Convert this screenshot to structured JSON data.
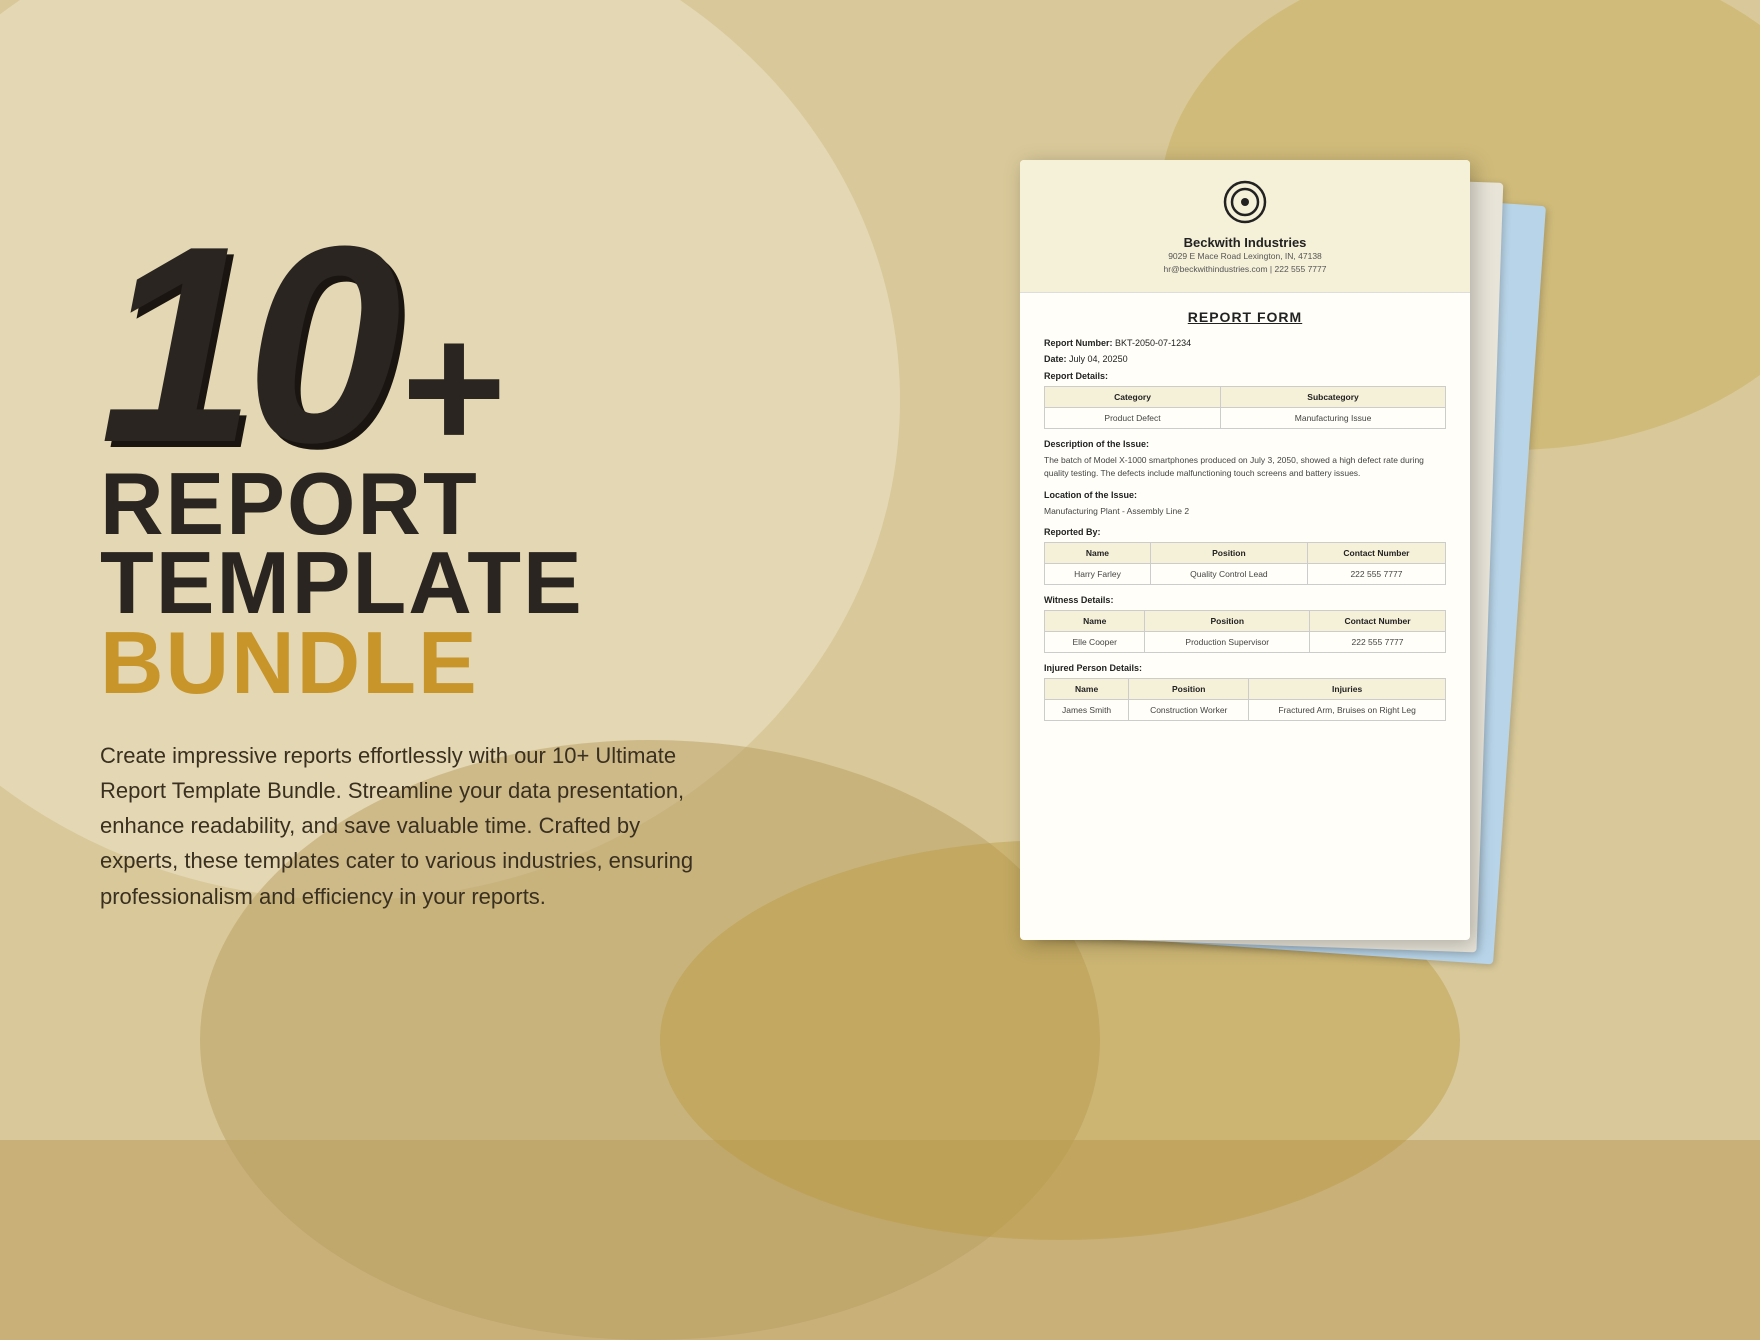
{
  "background": {
    "colors": {
      "main": "#d9c99a",
      "light_curve": "#e8ddbf",
      "dark_curve": "#b89d5e",
      "gold_curve": "#c4a84a"
    }
  },
  "left": {
    "big_number": "10",
    "plus_sign": "+",
    "line1": "REPORT",
    "line2": "TEMPLATE",
    "line3": "BUNDLE",
    "description": "Create impressive reports effortlessly with our 10+ Ultimate Report Template Bundle. Streamline your data presentation, enhance readability, and save valuable time. Crafted by experts, these templates cater to various industries, ensuring professionalism and efficiency in your reports."
  },
  "document": {
    "company": {
      "name": "Beckwith Industries",
      "address": "9029 E Mace Road Lexington, IN, 47138",
      "contact": "hr@beckwithindustries.com | 222 555 7777"
    },
    "title": "REPORT FORM",
    "report_number_label": "Report Number:",
    "report_number_value": "BKT-2050-07-1234",
    "date_label": "Date:",
    "date_value": "July 04, 20250",
    "report_details_label": "Report Details:",
    "categories_table": {
      "headers": [
        "Category",
        "Subcategory"
      ],
      "rows": [
        [
          "Product Defect",
          "Manufacturing Issue"
        ]
      ]
    },
    "description_label": "Description of the Issue:",
    "description_text": "The batch of Model X-1000 smartphones produced on July 3, 2050, showed a high defect rate during quality testing. The defects include malfunctioning touch screens and battery issues.",
    "location_label": "Location of the Issue:",
    "location_text": "Manufacturing Plant - Assembly Line 2",
    "reported_by_label": "Reported By:",
    "reported_by_table": {
      "headers": [
        "Name",
        "Position",
        "Contact Number"
      ],
      "rows": [
        [
          "Harry Farley",
          "Quality Control Lead",
          "222 555 7777"
        ]
      ]
    },
    "witness_label": "Witness Details:",
    "witness_table": {
      "headers": [
        "Name",
        "Position",
        "Contact Number"
      ],
      "rows": [
        [
          "Elle Cooper",
          "Production Supervisor",
          "222 555 7777"
        ]
      ]
    },
    "injured_label": "Injured Person Details:",
    "injured_table": {
      "headers": [
        "Name",
        "Position",
        "Injuries"
      ],
      "rows": [
        [
          "James Smith",
          "Construction Worker",
          "Fractured Arm, Bruises on Right Leg"
        ]
      ]
    }
  }
}
